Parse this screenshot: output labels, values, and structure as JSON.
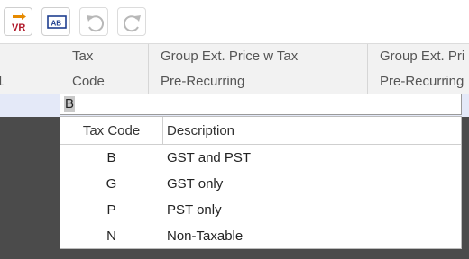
{
  "toolbar": {
    "buttons": [
      {
        "name": "vr-button",
        "icon": "vr-icon",
        "label": "VR"
      },
      {
        "name": "ab-button",
        "icon": "ab-icon",
        "label": "AB"
      },
      {
        "name": "undo-button",
        "icon": "undo-icon",
        "disabled": true
      },
      {
        "name": "redo-button",
        "icon": "redo-icon",
        "disabled": true
      }
    ]
  },
  "grid": {
    "columns": [
      {
        "line1": "",
        "line2": "1"
      },
      {
        "line1": "Tax",
        "line2": "Code"
      },
      {
        "line1": "Group Ext. Price w Tax",
        "line2": "Pre-Recurring"
      },
      {
        "line1": "Group Ext. Pri",
        "line2": "Pre-Recurring"
      }
    ]
  },
  "editor": {
    "value": "B"
  },
  "dropdown": {
    "headers": {
      "code": "Tax Code",
      "description": "Description"
    },
    "rows": [
      {
        "code": "B",
        "description": "GST and PST"
      },
      {
        "code": "G",
        "description": "GST only"
      },
      {
        "code": "P",
        "description": "PST only"
      },
      {
        "code": "N",
        "description": "Non-Taxable"
      }
    ]
  },
  "colors": {
    "header_bg": "#f2f2f2",
    "selected_row": "#e4e9f8",
    "overlay": "#4b4b4b",
    "vr_orange": "#e68a00",
    "vr_red": "#b0182a",
    "ab_blue": "#1f3f8f"
  }
}
